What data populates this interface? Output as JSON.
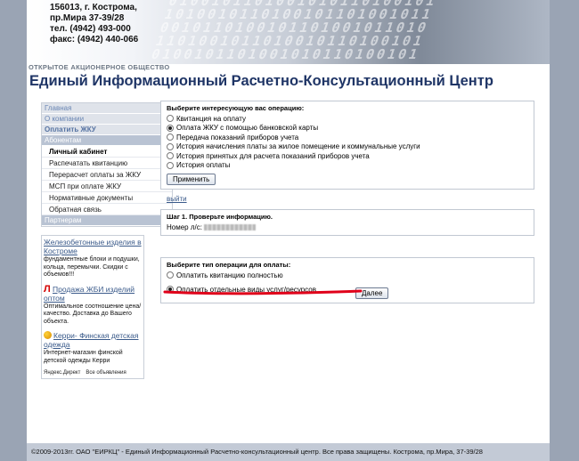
{
  "header": {
    "contacts": [
      "156013, г. Кострома,",
      "пр.Мира 37-39/28",
      "тел. (4942) 493-000",
      "факс: (4942) 440-066"
    ],
    "org_type": "ОТКРЫТОЕ АКЦИОНЕРНОЕ ОБЩЕСТВО",
    "org_name": "Единый Информационный Расчетно-Консультационный Центр"
  },
  "nav": {
    "items": [
      {
        "label": "Главная"
      },
      {
        "label": "О компании"
      },
      {
        "label": "Оплатить ЖКУ"
      },
      {
        "label": "Абонентам"
      },
      {
        "label": "Личный кабинет"
      },
      {
        "label": "Распечатать квитанцию"
      },
      {
        "label": "Перерасчет оплаты за ЖКУ"
      },
      {
        "label": "МСП при оплате ЖКУ"
      },
      {
        "label": "Нормативные документы"
      },
      {
        "label": "Обратная связь"
      },
      {
        "label": "Партнерам"
      }
    ]
  },
  "ads": {
    "items": [
      {
        "title": "Железобетонные изделия в Костроме",
        "text": "фундаментные блоки и подушки, кольца, перемычки. Скидки с объемов!!!"
      },
      {
        "title": "Продажа ЖБИ изделий оптом",
        "text": "Оптимальное соотношение цена/качество. Доставка до Вашего объекта."
      },
      {
        "title": "Керри- Финская детская одежда",
        "text": "Интернет-магазин финской детской одежды Керри"
      }
    ],
    "footer_left": "Яндекс.Директ",
    "footer_right": "Все объявления"
  },
  "operations": {
    "title": "Выберите интересующую вас операцию:",
    "options": [
      {
        "label": "Квитанция на оплату",
        "checked": false
      },
      {
        "label": "Оплата ЖКУ с помощью банковской карты",
        "checked": true
      },
      {
        "label": "Передача показаний приборов учета",
        "checked": false
      },
      {
        "label": "История начисления платы за жилое помещение и коммунальные услуги",
        "checked": false
      },
      {
        "label": "История принятых для расчета показаний приборов учета",
        "checked": false
      },
      {
        "label": "История оплаты",
        "checked": false
      }
    ],
    "apply_label": "Применить"
  },
  "logout_label": "выйти",
  "step1": {
    "title": "Шаг 1. Проверьте информацию.",
    "account_label": "Номер л/с:"
  },
  "payment_type": {
    "title": "Выберите тип операции для оплаты:",
    "options": [
      {
        "label": "Оплатить квитанцию полностью",
        "checked": false
      },
      {
        "label": "Оплатить отдельные виды услуг/ресурсов",
        "checked": true
      }
    ],
    "next_label": "Далее"
  },
  "footer": {
    "text": "©2009-2013гг. ОАО \"ЕИРКЦ\" - Единый Информационный Расчетно-консультационный центр. Все права защищены. Кострома, пр.Мира, 37-39/28"
  },
  "colors": {
    "header_title": "#1f3566",
    "link": "#3a5a8a",
    "annotation": "#e0001a"
  }
}
